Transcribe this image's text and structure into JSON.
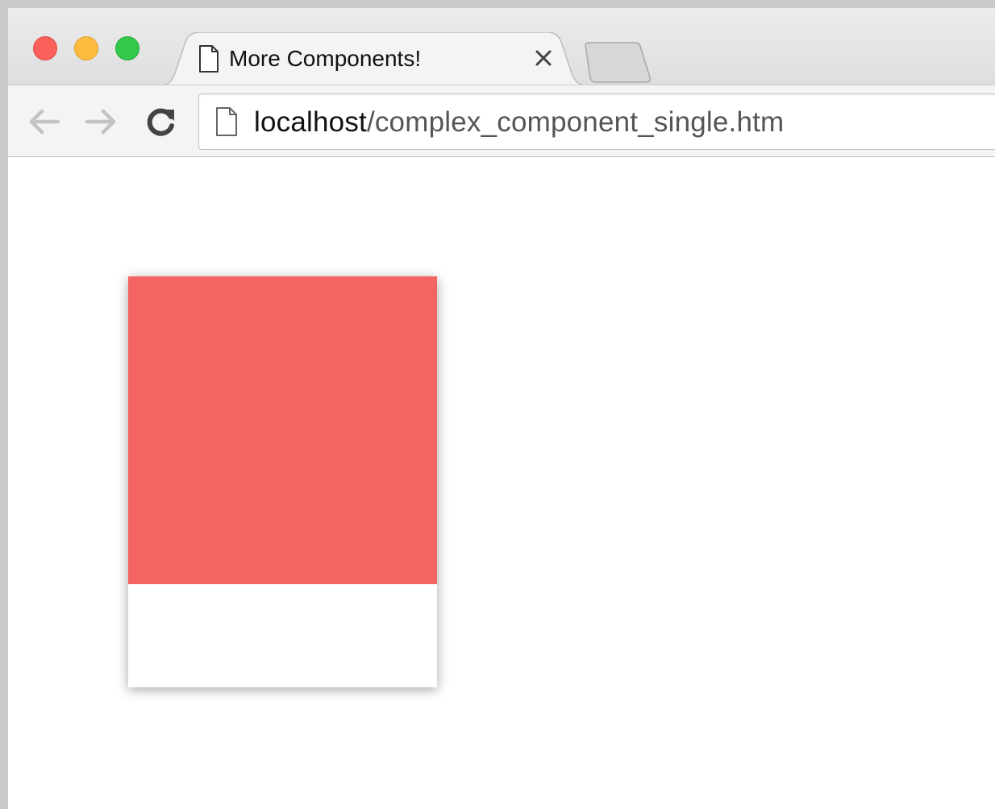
{
  "browser": {
    "tab": {
      "title": "More Components!"
    },
    "address": {
      "host": "localhost",
      "path": "/complex_component_single.htm"
    },
    "icons": {
      "close": "close-icon",
      "minimize": "minimize-icon",
      "maximize": "maximize-icon",
      "page": "page-icon",
      "tab_close": "tab-close-icon",
      "back": "back-arrow-icon",
      "forward": "forward-arrow-icon",
      "reload": "reload-icon"
    }
  },
  "content": {
    "card": {
      "square_color": "#f36462",
      "label_color": "#ffffff"
    }
  }
}
